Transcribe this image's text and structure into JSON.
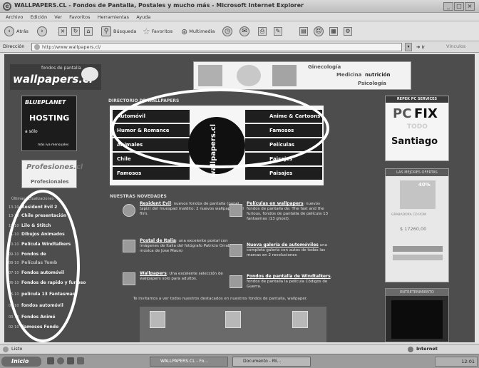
{
  "window": {
    "title": "WALLPAPERS.CL - Fondos de Pantalla, Postales y mucho más - Microsoft Internet Explorer"
  },
  "menu": [
    "Archivo",
    "Edición",
    "Ver",
    "Favoritos",
    "Herramientas",
    "Ayuda"
  ],
  "toolbar": {
    "back": "Atrás",
    "search": "Búsqueda",
    "favorites": "Favoritos",
    "multimedia": "Multimedia"
  },
  "address": {
    "label": "Dirección",
    "url": "http://www.wallpapers.cl/",
    "go": "Ir",
    "links": "Vínculos"
  },
  "site": {
    "logo_small": "fondos de pantalla",
    "logo_big": "wallpapers.cl",
    "banner_items": [
      "Ginecología",
      "Medicina",
      "nutrición",
      "Psicología"
    ],
    "hosting": {
      "brand": "BLUEPLANET",
      "title": "HOSTING",
      "price": "a sólo",
      "note": "más iva mensuales"
    },
    "profesionales": {
      "brand": "Profesiones.cl",
      "label": "Profesionales"
    },
    "dir_heading": "DIRECTORIO DE WALLPAPERS",
    "categories_left": [
      "Automóvil",
      "Humor & Romance",
      "Animales",
      "Chile",
      "Famosos"
    ],
    "categories_right": [
      "Anime & Cartoons",
      "Famosos",
      "Películas",
      "Paisajes",
      "Paisajes"
    ],
    "center_text": "wallpapers.cl",
    "sidebar_heading": "Últimas Actualizaciones",
    "sidebar_items": [
      {
        "date": "13-10",
        "label": "Resident Evil 2"
      },
      {
        "date": "13-10",
        "label": "Chile presentación"
      },
      {
        "date": "12-10",
        "label": "Lilo & Stitch"
      },
      {
        "date": "11-10",
        "label": "Dibujos Animados"
      },
      {
        "date": "10-10",
        "label": "Película Windtalkers"
      },
      {
        "date": "09-10",
        "label": "Fondos de"
      },
      {
        "date": "08-10",
        "label": "Películas Tomb"
      },
      {
        "date": "07-10",
        "label": "Fondos automóvil"
      },
      {
        "date": "06-10",
        "label": "Fondos de rapido y furioso"
      },
      {
        "date": "05-10",
        "label": "película 13 Fantasmas"
      },
      {
        "date": "04-10",
        "label": "fondos automóvil"
      },
      {
        "date": "03-10",
        "label": "Fondos Animé"
      },
      {
        "date": "02-10",
        "label": "Famosos Fondo"
      }
    ],
    "news_heading": "NUESTRAS NOVEDADES",
    "news": [
      {
        "title": "Resident Evil",
        "text": ": nuevos fondos de pantalla (papel tapiz) del muespad maldito: 2 nuevos wallpapers del film."
      },
      {
        "title": "Películas en wallpapers",
        "text": ": nuevos fondos de pantalla de: The fast and the furious, fondos de pantalla de película 13 fantasmas (13 ghost)."
      },
      {
        "title": "Postal de Italia",
        "text": ": una excelente postal con imágenes de Italia del fotógrafo Patricio Orrabo música de Jose Mauro"
      },
      {
        "title": "Nueva galería de automóviles",
        "text": " una completa galería con autos de todas las marcas en 2 revoluciones"
      },
      {
        "title": "Wallpapers",
        "text": ": Una excelente selección de wallpapers solo para adultos."
      },
      {
        "title": "Fondos de pantalla de Windtalkers",
        "text": ", fondos de pantalla la película Códigos de Guerra."
      }
    ],
    "promo": "Te invitamos a ver todos nuestros destacados en nuestros fondos de pantalla, wallpaper.",
    "pcfix": {
      "header": "REPEK PC SERVICES",
      "brand1": "PC",
      "brand2": "FIX",
      "sub": "TODO",
      "city": "Santiago"
    },
    "ofertas": {
      "header": "LAS MEJORES OFERTAS",
      "badge": "40%",
      "desc": "GRABADORA CD ROM",
      "price": "$ 17260,00"
    },
    "enter": {
      "header": "ENTRETENIMIENTO"
    }
  },
  "status": {
    "left": "Listo",
    "zone": "Internet"
  },
  "taskbar": {
    "start": "Inicio",
    "tasks": [
      "WALLPAPERS.CL - Fo...",
      "Documento - Mi..."
    ],
    "clock": "12:01"
  }
}
